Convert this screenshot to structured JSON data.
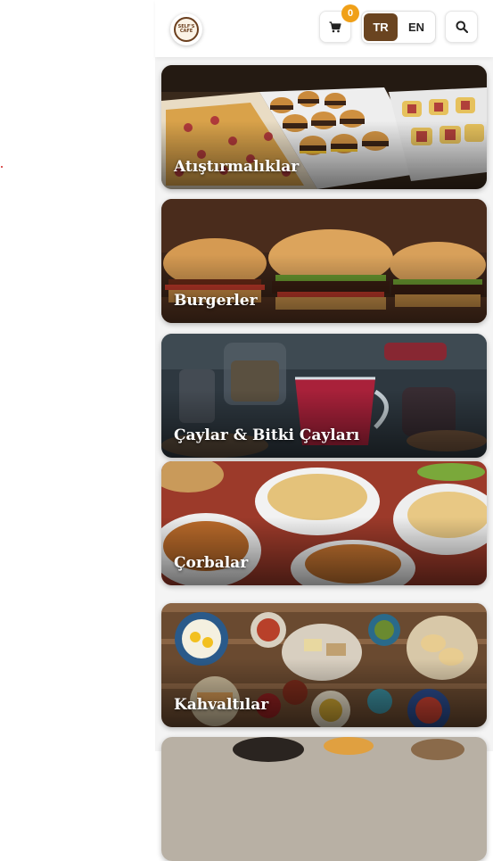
{
  "header": {
    "logo_line1": "SELF'S",
    "logo_line2": "CAFE",
    "cart_count": "0",
    "cart_icon": "cart-icon",
    "search_icon": "search-icon",
    "languages": [
      {
        "label": "TR",
        "active": true
      },
      {
        "label": "EN",
        "active": false
      }
    ],
    "accent_color": "#6a4420",
    "badge_color": "#f0a018"
  },
  "categories": [
    {
      "label": "Atıştırmalıklar"
    },
    {
      "label": "Burgerler"
    },
    {
      "label": "Çaylar & Bitki Çayları"
    },
    {
      "label": "Çorbalar"
    },
    {
      "label": "Kahvaltılar"
    },
    {
      "label": ""
    }
  ]
}
